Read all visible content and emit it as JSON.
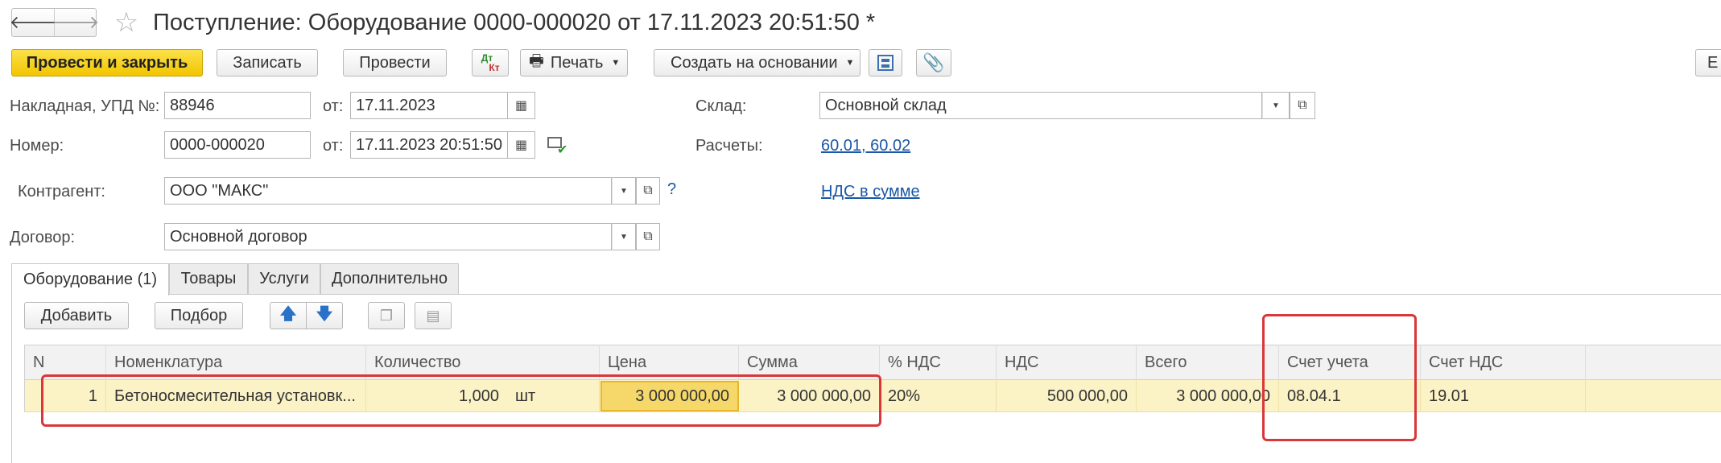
{
  "window": {
    "title": "Поступление: Оборудование 0000-000020 от 17.11.2023 20:51:50 *"
  },
  "toolbar": {
    "post_and_close": "Провести и закрыть",
    "save": "Записать",
    "post": "Провести",
    "dt_kt_top": "Дт",
    "dt_kt_bottom": "Кт",
    "print": "Печать",
    "create_based": "Создать на основании",
    "partial_right": "Е"
  },
  "form": {
    "invoice_label": "Накладная, УПД №:",
    "invoice_value": "88946",
    "from_label_1": "от:",
    "invoice_date": "17.11.2023",
    "number_label": "Номер:",
    "number_value": "0000-000020",
    "from_label_2": "от:",
    "number_date": "17.11.2023 20:51:50",
    "warehouse_label": "Склад:",
    "warehouse_value": "Основной склад",
    "settlements_label": "Расчеты:",
    "settlements_link": "60.01, 60.02",
    "counterparty_label": "Контрагент:",
    "counterparty_value": "ООО \"МАКС\"",
    "question_mark": "?",
    "vat_link": "НДС в сумме",
    "contract_label": "Договор:",
    "contract_value": "Основной договор"
  },
  "tabs": [
    {
      "label": "Оборудование (1)"
    },
    {
      "label": "Товары"
    },
    {
      "label": "Услуги"
    },
    {
      "label": "Дополнительно"
    }
  ],
  "table_toolbar": {
    "add": "Добавить",
    "select": "Подбор"
  },
  "table": {
    "columns": [
      "N",
      "Номенклатура",
      "Количество",
      "Цена",
      "Сумма",
      "% НДС",
      "НДС",
      "Всего",
      "Счет учета",
      "Счет НДС"
    ],
    "rows": [
      {
        "n": "1",
        "item": "Бетоносмесительная установк...",
        "qty": "1,000",
        "unit": "шт",
        "price": "3 000 000,00",
        "sum": "3 000 000,00",
        "vat_rate": "20%",
        "vat": "500 000,00",
        "total": "3 000 000,00",
        "account": "08.04.1",
        "vat_account": "19.01"
      }
    ]
  },
  "colors": {
    "primary_button": "#f2c500",
    "selected_row": "#fbf2c6",
    "active_cell": "#f6d86a",
    "link": "#1a57a6",
    "highlight_box": "#d9373a"
  }
}
